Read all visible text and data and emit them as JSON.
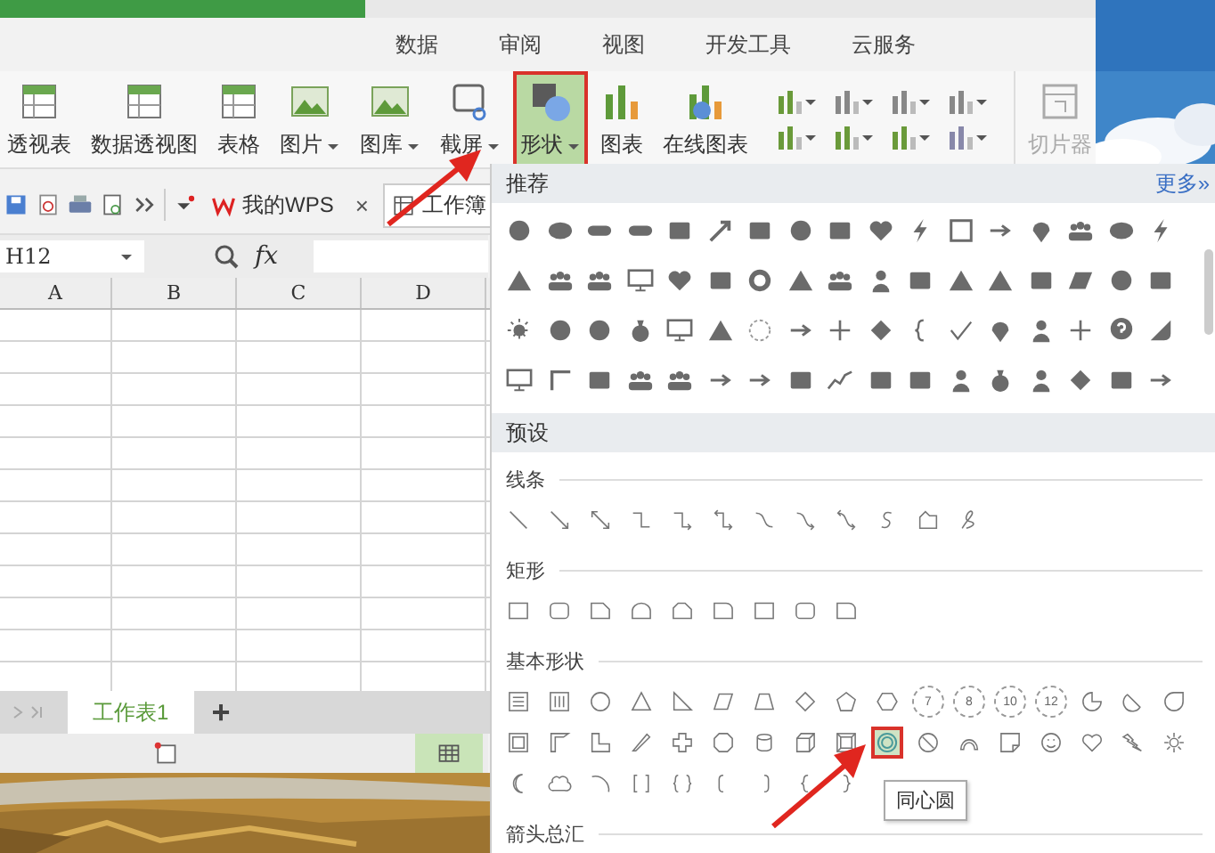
{
  "tabs": [
    {
      "label": "数据",
      "selected": false
    },
    {
      "label": "审阅",
      "selected": false
    },
    {
      "label": "视图",
      "selected": false
    },
    {
      "label": "开发工具",
      "selected": false
    },
    {
      "label": "云服务",
      "selected": false
    }
  ],
  "ribbon": [
    {
      "kind": "large",
      "label": "透视表",
      "has_menu": false,
      "selected": false,
      "disabled": false
    },
    {
      "kind": "large",
      "label": "数据透视图",
      "has_menu": false,
      "selected": false,
      "disabled": false
    },
    {
      "kind": "large",
      "label": "表格",
      "has_menu": false,
      "selected": false,
      "disabled": false
    },
    {
      "kind": "large",
      "label": "图片",
      "has_menu": true,
      "selected": false,
      "disabled": false
    },
    {
      "kind": "large",
      "label": "图库",
      "has_menu": true,
      "selected": false,
      "disabled": false
    },
    {
      "kind": "large",
      "label": "截屏",
      "has_menu": true,
      "selected": false,
      "disabled": false
    },
    {
      "kind": "large",
      "label": "形状",
      "has_menu": true,
      "selected": true,
      "disabled": false
    },
    {
      "kind": "large",
      "label": "图表",
      "has_menu": false,
      "selected": false,
      "disabled": false
    },
    {
      "kind": "large",
      "label": "在线图表",
      "has_menu": false,
      "selected": false,
      "disabled": false
    },
    {
      "kind": "chart-grid"
    },
    {
      "kind": "large",
      "label": "切片器",
      "has_menu": false,
      "selected": false,
      "disabled": true
    }
  ],
  "doc_tabs": [
    {
      "label": "我的WPS",
      "close": "×",
      "selected": false
    },
    {
      "label": "工作簿",
      "selected": true
    }
  ],
  "formula_bar": {
    "cell": "H12",
    "fx": "fx"
  },
  "columns": [
    "A",
    "B",
    "C",
    "D"
  ],
  "sheet_tabs": [
    {
      "label": "工作表1",
      "selected": true
    }
  ],
  "add_sheet": "+",
  "shapes_panel": {
    "recommended_title": "推荐",
    "more": "更多»",
    "preset_title": "预设",
    "sections": [
      {
        "title": "线条",
        "items": [
          {
            "selected": false
          },
          {
            "selected": false
          },
          {
            "selected": false
          },
          {
            "selected": false
          },
          {
            "selected": false
          },
          {
            "selected": false
          },
          {
            "selected": false
          },
          {
            "selected": false
          },
          {
            "selected": false
          },
          {
            "selected": false
          },
          {
            "selected": false
          },
          {
            "selected": false
          }
        ]
      },
      {
        "title": "矩形",
        "items": [
          {
            "selected": false
          },
          {
            "selected": false
          },
          {
            "selected": false
          },
          {
            "selected": false
          },
          {
            "selected": false
          },
          {
            "selected": false
          },
          {
            "selected": false
          },
          {
            "selected": false
          },
          {
            "selected": false
          }
        ]
      },
      {
        "title": "基本形状",
        "items": [
          {
            "selected": false
          },
          {
            "selected": false
          },
          {
            "selected": false
          },
          {
            "selected": false
          },
          {
            "selected": false
          },
          {
            "selected": false
          },
          {
            "selected": false
          },
          {
            "selected": false
          },
          {
            "selected": false
          },
          {
            "selected": false
          },
          {
            "selected": false,
            "label": "7"
          },
          {
            "selected": false,
            "label": "8"
          },
          {
            "selected": false,
            "label": "10"
          },
          {
            "selected": false,
            "label": "12"
          },
          {
            "selected": false
          },
          {
            "selected": false
          },
          {
            "selected": false
          },
          {
            "selected": false
          },
          {
            "selected": false
          },
          {
            "selected": false
          },
          {
            "selected": false
          },
          {
            "selected": false
          },
          {
            "selected": false
          },
          {
            "selected": false
          },
          {
            "selected": false
          },
          {
            "selected": false
          },
          {
            "selected": true
          },
          {
            "selected": false
          },
          {
            "selected": false
          },
          {
            "selected": false
          },
          {
            "selected": false
          },
          {
            "selected": false
          },
          {
            "selected": false
          },
          {
            "selected": false
          },
          {
            "selected": false
          },
          {
            "selected": false
          },
          {
            "selected": false
          },
          {
            "selected": false
          },
          {
            "selected": false
          },
          {
            "selected": false
          },
          {
            "selected": false
          },
          {
            "selected": false
          },
          {
            "selected": false
          }
        ]
      }
    ],
    "tooltip": "同心圆",
    "next_section": "箭头总汇"
  }
}
